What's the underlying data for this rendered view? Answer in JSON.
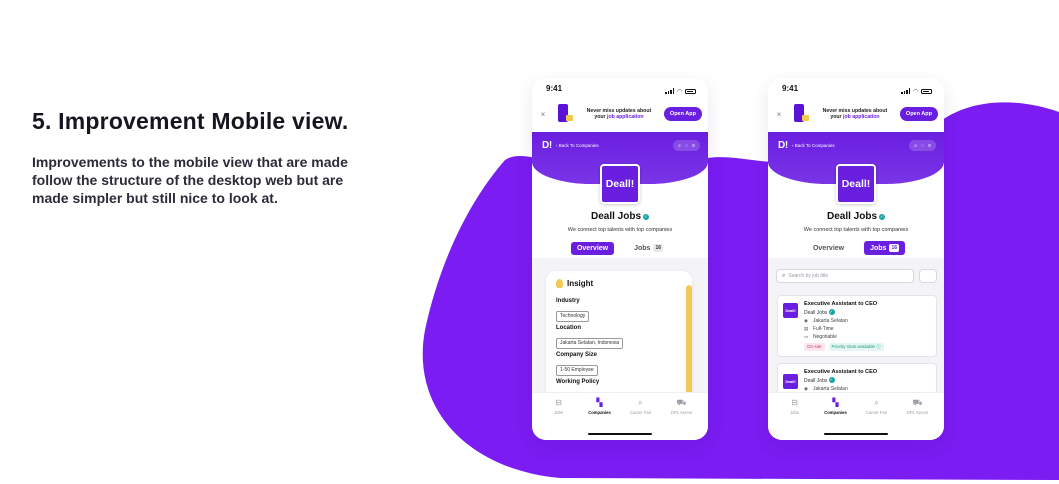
{
  "slide": {
    "heading": "5. Improvement Mobile view.",
    "description": "Improvements to the mobile view that are made follow the structure of the desktop web but are made simpler but still nice to look at."
  },
  "colors": {
    "brand": "#6a1ee0",
    "accent_yellow": "#f4c95a",
    "verified": "#19a3a3"
  },
  "phones": [
    {
      "status_time": "9:41",
      "banner": {
        "line1": "Never miss updates about",
        "line2_prefix": "your ",
        "line2_highlight": "job application",
        "open_app": "Open App",
        "close": "×"
      },
      "hero": {
        "logo": "D!",
        "back": "‹  Back To Companies"
      },
      "company": {
        "logo_text": "Deall!",
        "name": "Deall Jobs",
        "tagline": "We connect top talents with top companies"
      },
      "tabs": [
        {
          "label": "Overview",
          "active": true
        },
        {
          "label": "Jobs",
          "count": "16",
          "active": false
        }
      ],
      "insight": {
        "title": "Insight",
        "fields": [
          {
            "label": "Industry",
            "value": "Technology"
          },
          {
            "label": "Location",
            "value": "Jakarta Selatan, Indonesia"
          },
          {
            "label": "Company Size",
            "value": "1-50 Employee"
          },
          {
            "label": "Working Policy",
            "value": ""
          }
        ]
      },
      "nav": [
        {
          "label": "Jobs",
          "icon": "briefcase-icon",
          "active": false
        },
        {
          "label": "Companies",
          "icon": "building-icon",
          "active": true
        },
        {
          "label": "Career Fair",
          "icon": "career-fair-icon",
          "active": false
        },
        {
          "label": "DPL Xenon",
          "icon": "dpl-icon",
          "active": false
        }
      ]
    },
    {
      "status_time": "9:41",
      "banner": {
        "line1": "Never miss updates about",
        "line2_prefix": "your ",
        "line2_highlight": "job application",
        "open_app": "Open App",
        "close": "×"
      },
      "hero": {
        "logo": "D!",
        "back": "‹  Back To Companies"
      },
      "company": {
        "logo_text": "Deall!",
        "name": "Deall Jobs",
        "tagline": "We connect top talents with top companies"
      },
      "tabs": [
        {
          "label": "Overview",
          "active": false
        },
        {
          "label": "Jobs",
          "count": "16",
          "active": true
        }
      ],
      "search": {
        "placeholder": "Search by job title"
      },
      "jobs": [
        {
          "logo": "Deall!",
          "title": "Executive Assistant to CEO",
          "company": "Deall Jobs",
          "location": "Jakarta Selatan",
          "type": "Full-Time",
          "salary": "Negotiable",
          "chip1": "On-site",
          "chip2": "Priority slots available ⓘ"
        },
        {
          "logo": "Deall!",
          "title": "Executive Assistant to CEO",
          "company": "Deall Jobs",
          "location": "Jakarta Selatan"
        }
      ],
      "nav": [
        {
          "label": "Jobs",
          "icon": "briefcase-icon",
          "active": false
        },
        {
          "label": "Companies",
          "icon": "building-icon",
          "active": true
        },
        {
          "label": "Career Fair",
          "icon": "career-fair-icon",
          "active": false
        },
        {
          "label": "DPL Xenon",
          "icon": "dpl-icon",
          "active": false
        }
      ]
    }
  ]
}
